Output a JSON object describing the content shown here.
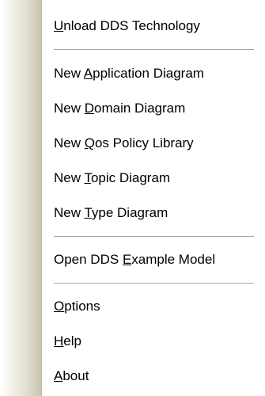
{
  "menu": {
    "items": [
      {
        "pre": "",
        "key": "U",
        "post": "nload DDS Technology"
      },
      {
        "pre": "New ",
        "key": "A",
        "post": "pplication Diagram"
      },
      {
        "pre": "New ",
        "key": "D",
        "post": "omain Diagram"
      },
      {
        "pre": "New ",
        "key": "Q",
        "post": "os Policy Library"
      },
      {
        "pre": "New ",
        "key": "T",
        "post": "opic Diagram"
      },
      {
        "pre": "New ",
        "key": "T",
        "post": "ype Diagram"
      },
      {
        "pre": "Open DDS ",
        "key": "E",
        "post": "xample Model"
      },
      {
        "pre": "",
        "key": "O",
        "post": "ptions"
      },
      {
        "pre": "",
        "key": "H",
        "post": "elp"
      },
      {
        "pre": "",
        "key": "A",
        "post": "bout"
      }
    ]
  },
  "colors": {
    "background": "#ffffff",
    "gutter": "#cac5b1",
    "separator": "#a6a6a6",
    "text": "#000000"
  }
}
